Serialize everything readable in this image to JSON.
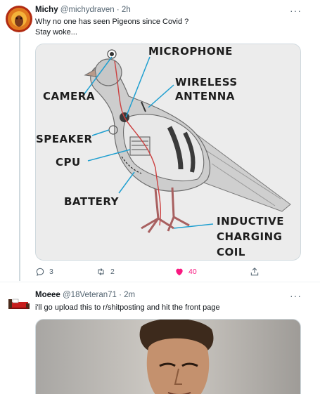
{
  "tweet1": {
    "display_name": "Michy",
    "handle": "@michydraven",
    "sep": "·",
    "time": "2h",
    "text_line1": "Why no one has seen Pigeons since Covid ?",
    "text_line2": "Stay woke...",
    "more": "···",
    "image": {
      "labels": {
        "microphone": "MICROPHONE",
        "wireless_1": "WIRELESS",
        "wireless_2": "ANTENNA",
        "camera": "CAMERA",
        "speaker": "SPEAKER",
        "cpu": "CPU",
        "battery": "BATTERY",
        "inductive_1": "INDUCTIVE",
        "inductive_2": "CHARGING",
        "inductive_3": "COIL"
      }
    },
    "actions": {
      "reply_count": "3",
      "retweet_count": "2",
      "like_count": "40",
      "like_color": "#f91880"
    }
  },
  "tweet2": {
    "display_name": "Moeee",
    "handle": "@18Veteran71",
    "sep": "·",
    "time": "2m",
    "text": "i'll go upload this to r/shitposting and hit the front page",
    "more": "···"
  }
}
